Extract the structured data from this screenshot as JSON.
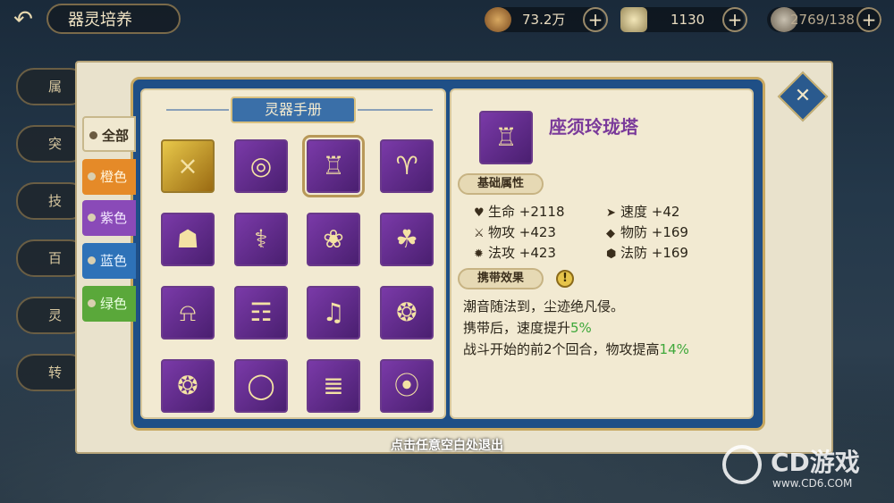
{
  "header": {
    "back_icon": "back-arrow-icon",
    "title": "器灵培养",
    "resources": [
      {
        "icon": "coin-icon",
        "value": "73.2万"
      },
      {
        "icon": "ingot-icon",
        "value": "1130"
      },
      {
        "icon": "stamina-icon",
        "value": "2769/138"
      }
    ]
  },
  "side_tabs": [
    "属",
    "突",
    "技",
    "百",
    "灵",
    "转"
  ],
  "handbook": {
    "title": "灵器手册",
    "filters": [
      {
        "label": "全部",
        "color": "#f0e8d0",
        "active": true
      },
      {
        "label": "橙色",
        "color": "#e58a28",
        "active": false
      },
      {
        "label": "紫色",
        "color": "#8a4ab8",
        "active": false
      },
      {
        "label": "蓝色",
        "color": "#2e72b8",
        "active": false
      },
      {
        "label": "绿色",
        "color": "#5aa83a",
        "active": false
      }
    ],
    "items": [
      {
        "icon": "crossbow-icon",
        "rarity": "orange",
        "selected": false
      },
      {
        "icon": "dragon-ring-icon",
        "rarity": "purple",
        "selected": false
      },
      {
        "icon": "pagoda-icon",
        "rarity": "purple",
        "selected": true
      },
      {
        "icon": "ram-statue-icon",
        "rarity": "purple",
        "selected": false
      },
      {
        "icon": "gourd-icon",
        "rarity": "purple",
        "selected": false
      },
      {
        "icon": "golden-staff-icon",
        "rarity": "purple",
        "selected": false
      },
      {
        "icon": "lotus-wand-icon",
        "rarity": "purple",
        "selected": false
      },
      {
        "icon": "jade-beast-icon",
        "rarity": "purple",
        "selected": false
      },
      {
        "icon": "bell-icon",
        "rarity": "purple",
        "selected": false
      },
      {
        "icon": "scroll-icon",
        "rarity": "purple",
        "selected": false
      },
      {
        "icon": "pipa-icon",
        "rarity": "purple",
        "selected": false
      },
      {
        "icon": "lantern-spear-icon",
        "rarity": "purple",
        "selected": false
      },
      {
        "icon": "fan-icon",
        "rarity": "purple",
        "selected": false
      },
      {
        "icon": "jade-bracelet-icon",
        "rarity": "purple",
        "selected": false
      },
      {
        "icon": "red-talisman-icon",
        "rarity": "purple",
        "selected": false
      },
      {
        "icon": "prayer-beads-icon",
        "rarity": "purple",
        "selected": false
      }
    ]
  },
  "detail": {
    "name": "座须玲珑塔",
    "thumb_icon": "pagoda-icon",
    "base_label": "基础属性",
    "stats": [
      {
        "icon": "heart-icon",
        "label": "生命 +2118"
      },
      {
        "icon": "speed-icon",
        "label": "速度 +42"
      },
      {
        "icon": "sword-icon",
        "label": "物攻 +423"
      },
      {
        "icon": "shield-icon",
        "label": "物防 +169"
      },
      {
        "icon": "magic-atk-icon",
        "label": "法攻 +423"
      },
      {
        "icon": "magic-def-icon",
        "label": "法防 +169"
      }
    ],
    "effect_label": "携带效果",
    "effect_lines": {
      "line1": "潮音随法到，尘迹绝凡侵。",
      "line2_pre": "携带后，速度提升",
      "line2_hl": "5%",
      "line3_pre": "战斗开始的前2个回合，物攻提高",
      "line3_hl": "14%"
    }
  },
  "close_hint": "点击任意空白处退出",
  "watermark": {
    "title": "CD游戏",
    "url": "www.CD6.COM"
  }
}
